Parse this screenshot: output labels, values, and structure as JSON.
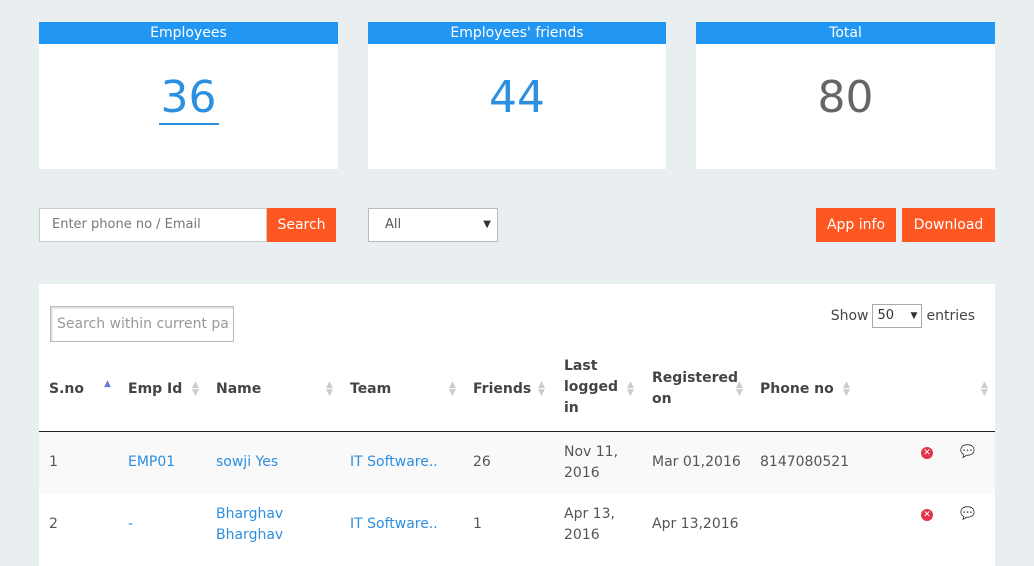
{
  "stats": {
    "employees": {
      "label": "Employees",
      "value": "36"
    },
    "friends": {
      "label": "Employees' friends",
      "value": "44"
    },
    "total": {
      "label": "Total",
      "value": "80"
    }
  },
  "toolbar": {
    "search_placeholder": "Enter phone no / Email",
    "search_button": "Search",
    "filter_selected": "All",
    "app_info_button": "App info",
    "download_button": "Download"
  },
  "table": {
    "search_placeholder": "Search within current pa",
    "show_label": "Show",
    "page_size": "50",
    "entries_label": "entries",
    "columns": [
      "S.no",
      "Emp Id",
      "Name",
      "Team",
      "Friends",
      "Last logged in",
      "Registered on",
      "Phone no"
    ],
    "rows": [
      {
        "sno": "1",
        "emp_id": "EMP01",
        "name": "sowji Yes",
        "team": "IT Software..",
        "friends": "26",
        "last_logged_in": "Nov 11, 2016",
        "registered_on": "Mar 01,2016",
        "phone": "8147080521"
      },
      {
        "sno": "2",
        "emp_id": "-",
        "name": "Bharghav Bharghav",
        "team": "IT Software..",
        "friends": "1",
        "last_logged_in": "Apr 13, 2016",
        "registered_on": "Apr 13,2016",
        "phone": ""
      }
    ]
  },
  "colors": {
    "primary": "#2196f3",
    "accent": "#fe5722",
    "background": "#e9eef1"
  },
  "icons": {
    "delete": "close-circle-icon",
    "message": "chat-icon"
  }
}
